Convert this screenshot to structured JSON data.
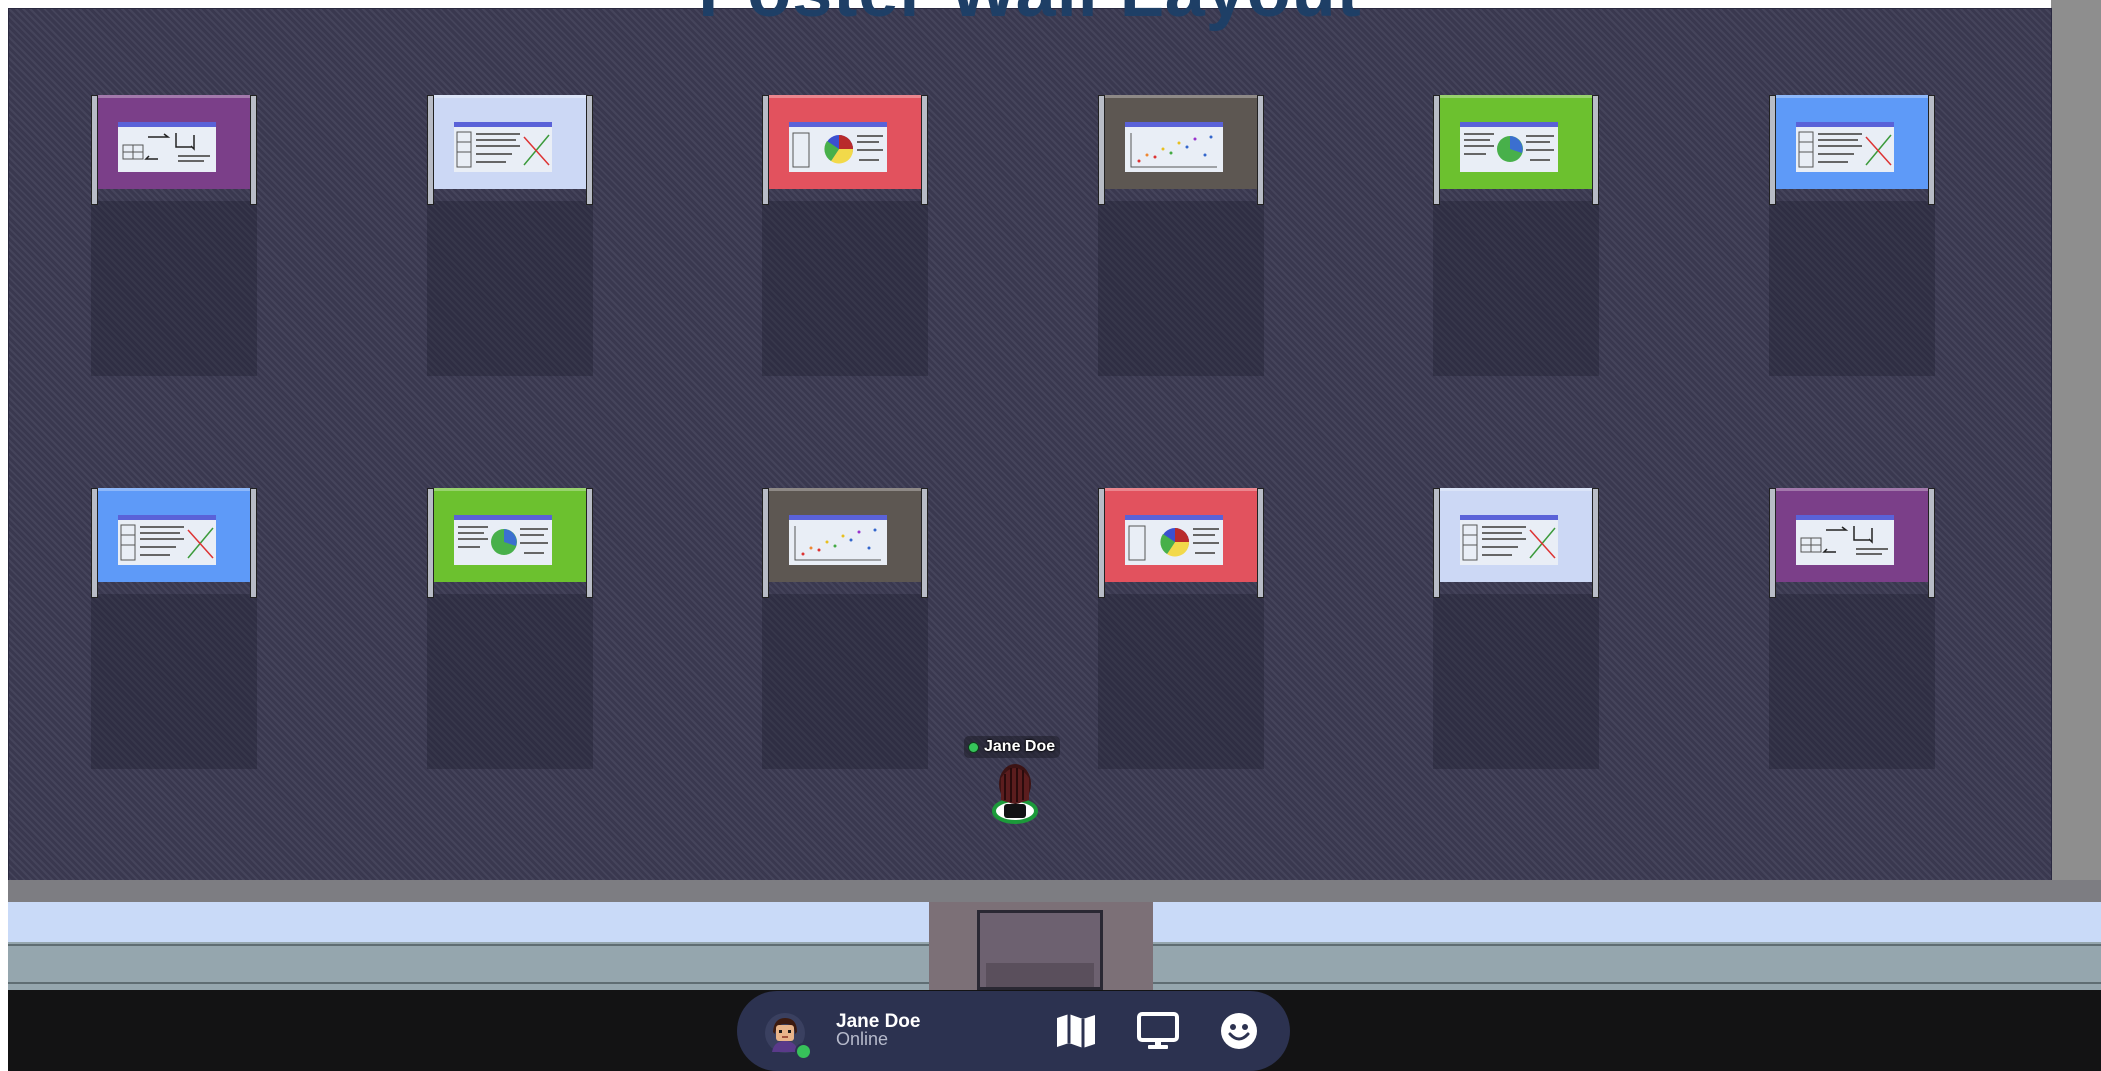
{
  "room": {
    "title": "Poster Wall Layout"
  },
  "user": {
    "name": "Jane Doe",
    "status": "Online"
  },
  "dock": {
    "buttons": [
      {
        "name": "map-button",
        "icon": "map-icon"
      },
      {
        "name": "screen-share-button",
        "icon": "monitor-icon"
      },
      {
        "name": "emote-button",
        "icon": "smiley-icon"
      }
    ]
  },
  "colors": {
    "floor": "#3d3c54",
    "wall": "#c9daf8",
    "dock_bg": "#2c3250",
    "online": "#37c15a",
    "poster_palette": {
      "purple": "#7b3f89",
      "lavender": "#ccd8f5",
      "red": "#e2525e",
      "gray": "#5d5752",
      "green": "#6cc12f",
      "blue": "#5e9af8"
    }
  },
  "posters": [
    {
      "row": 1,
      "color": "purple",
      "content": "flowchart"
    },
    {
      "row": 1,
      "color": "lavender",
      "content": "text-line-chart"
    },
    {
      "row": 1,
      "color": "red",
      "content": "pie-chart"
    },
    {
      "row": 1,
      "color": "gray",
      "content": "scatter-plot"
    },
    {
      "row": 1,
      "color": "green",
      "content": "text-pie"
    },
    {
      "row": 1,
      "color": "blue",
      "content": "text-line-chart"
    },
    {
      "row": 2,
      "color": "blue",
      "content": "text-line-chart"
    },
    {
      "row": 2,
      "color": "green",
      "content": "text-pie"
    },
    {
      "row": 2,
      "color": "gray",
      "content": "scatter-plot"
    },
    {
      "row": 2,
      "color": "red",
      "content": "pie-chart"
    },
    {
      "row": 2,
      "color": "lavender",
      "content": "text-line-chart"
    },
    {
      "row": 2,
      "color": "purple",
      "content": "flowchart"
    }
  ]
}
